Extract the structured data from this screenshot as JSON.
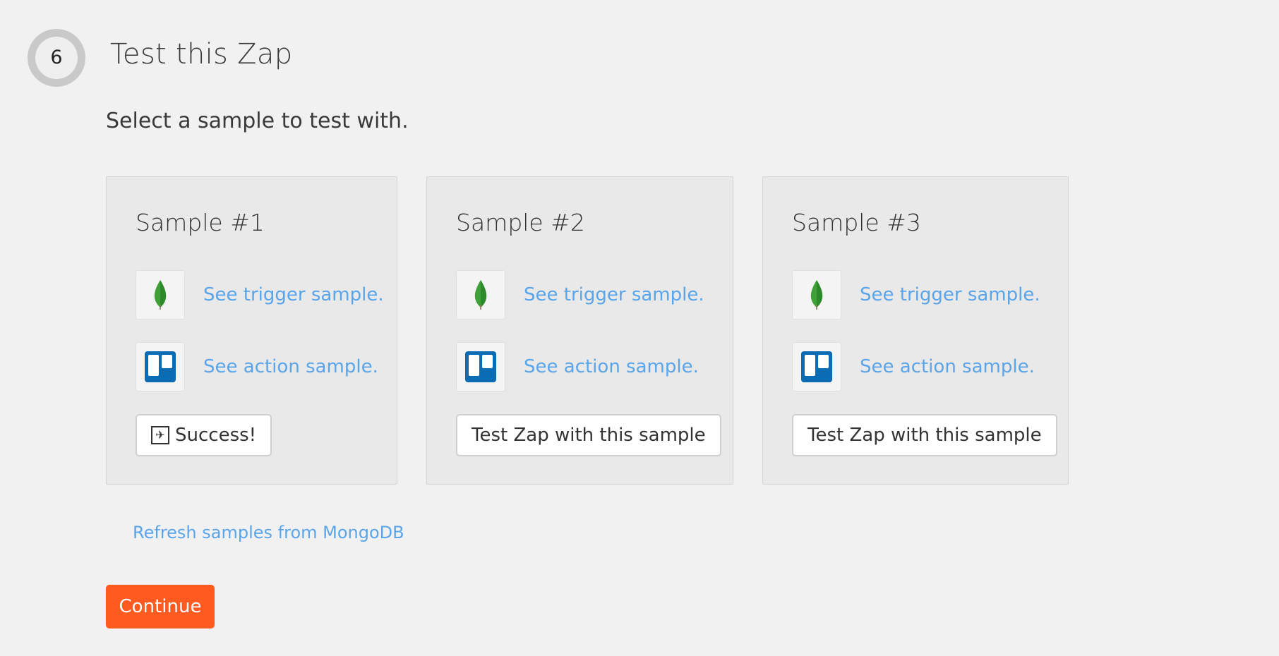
{
  "step": {
    "number": "6",
    "title": "Test this Zap"
  },
  "subtitle": "Select a sample to test with.",
  "samples": [
    {
      "title": "Sample #1",
      "trigger_link": "See trigger sample.",
      "action_link": "See action sample.",
      "button_label": "Success!",
      "button_icon": "paper-plane-icon"
    },
    {
      "title": "Sample #2",
      "trigger_link": "See trigger sample.",
      "action_link": "See action sample.",
      "button_label": "Test Zap with this sample"
    },
    {
      "title": "Sample #3",
      "trigger_link": "See trigger sample.",
      "action_link": "See action sample.",
      "button_label": "Test Zap with this sample"
    }
  ],
  "icons": {
    "trigger_app": "mongodb-leaf-icon",
    "action_app": "trello-icon"
  },
  "refresh_link": "Refresh samples from MongoDB",
  "continue_label": "Continue",
  "colors": {
    "link": "#5aa5ea",
    "continue_bg": "#ff5a1f",
    "mongodb_green": "#3fa037",
    "trello_blue": "#0b6bb3"
  }
}
